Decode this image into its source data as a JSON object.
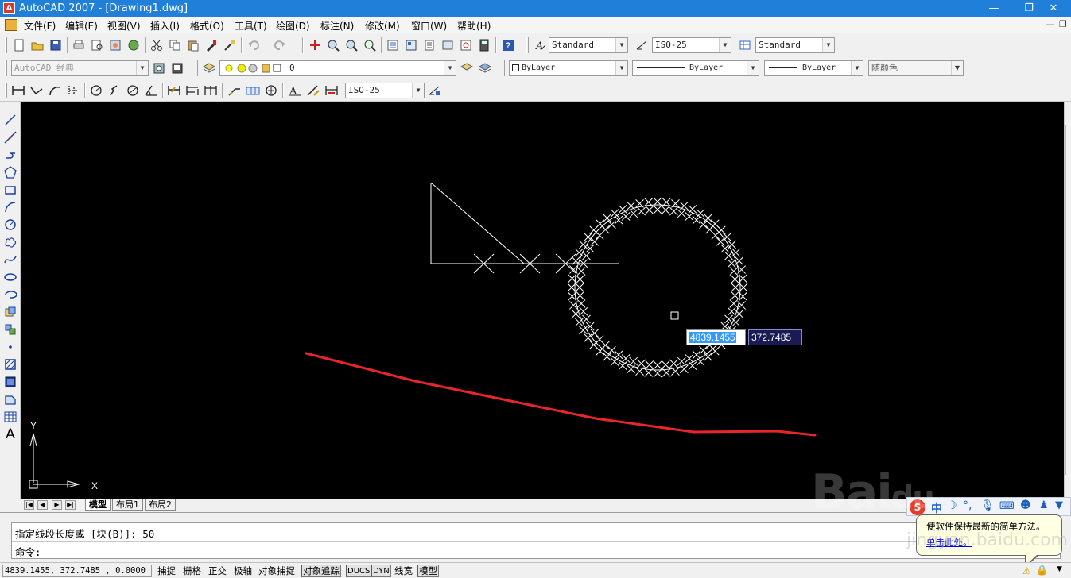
{
  "window": {
    "title": "AutoCAD 2007 - [Drawing1.dwg]",
    "controls": [
      "—",
      "❐",
      "✕"
    ],
    "mdi_controls": [
      "—",
      "❐"
    ]
  },
  "menu": {
    "items": [
      "文件(F)",
      "编辑(E)",
      "视图(V)",
      "插入(I)",
      "格式(O)",
      "工具(T)",
      "绘图(D)",
      "标注(N)",
      "修改(M)",
      "窗口(W)",
      "帮助(H)"
    ]
  },
  "toolbar1": {
    "text_style": "Standard",
    "dim_style": "ISO-25",
    "table_style": "Standard"
  },
  "toolbar2": {
    "workspace": "AutoCAD 经典",
    "layer": "0",
    "color": "ByLayer",
    "linetype": "ByLayer",
    "lineweight": "ByLayer",
    "plotstyle": "随颜色"
  },
  "toolbar3": {
    "dim_style": "ISO-25"
  },
  "canvas": {
    "dyn_x": "4839.1455",
    "dyn_y": "372.7485",
    "ucs_x": "X",
    "ucs_y": "Y",
    "annotation_color": "#e8262a"
  },
  "layout_tabs": {
    "nav": [
      "|◀",
      "◀",
      "▶",
      "▶|"
    ],
    "tabs": [
      "模型",
      "布局1",
      "布局2"
    ]
  },
  "command": {
    "history": "指定线段长度或 [块(B)]: 50",
    "prompt": "命令:"
  },
  "status": {
    "coords": "4839.1455, 372.7485 , 0.0000",
    "buttons": [
      {
        "label": "捕捉",
        "on": false
      },
      {
        "label": "栅格",
        "on": false
      },
      {
        "label": "正交",
        "on": false
      },
      {
        "label": "极轴",
        "on": false
      },
      {
        "label": "对象捕捉",
        "on": false
      },
      {
        "label": "对象追踪",
        "on": true
      },
      {
        "label": "DUCS",
        "on": true
      },
      {
        "label": "DYN",
        "on": true
      },
      {
        "label": "线宽",
        "on": false
      },
      {
        "label": "模型",
        "on": true
      }
    ]
  },
  "ime": {
    "lang": "中"
  },
  "balloon": {
    "text": "使软件保持最新的简单方法。",
    "link": "单击此处。"
  },
  "watermark": {
    "brand": "Baidu经验",
    "url": "jingyan.baidu.com"
  }
}
